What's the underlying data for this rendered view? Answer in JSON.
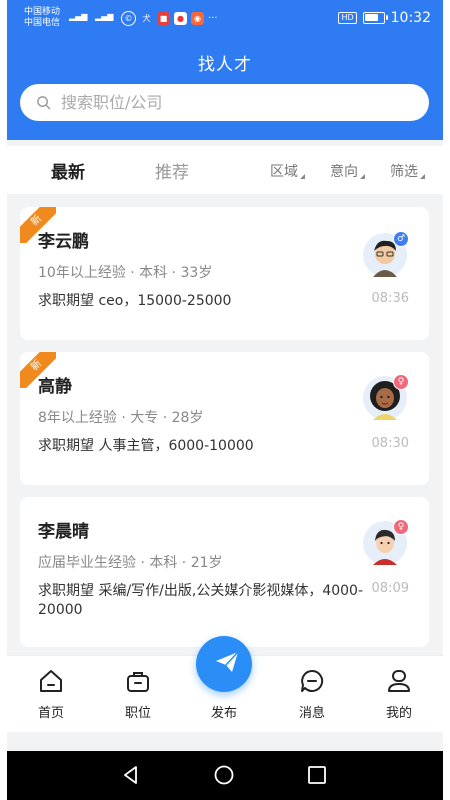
{
  "status_bar": {
    "carrier_1": "中国移动",
    "carrier_2": "中国电信",
    "time": "10:32",
    "hd": "HD",
    "battery_level": 0.8,
    "app_icons": [
      "alipay-like-icon",
      "weibo-icon",
      "map-pin-icon",
      "fox-icon"
    ],
    "more": "···"
  },
  "header": {
    "title": "找人才",
    "search_placeholder": "搜索职位/公司"
  },
  "filters": {
    "tabs": [
      "最新",
      "推荐"
    ],
    "dropdowns": [
      "区域",
      "意向",
      "筛选"
    ]
  },
  "candidates": [
    {
      "name": "李云鹏",
      "meta": "10年以上经验 · 本科 · 33岁",
      "expect": "求职期望 ceo，15000-25000",
      "time": "08:36",
      "is_new": true,
      "new_label": "新",
      "gender": "male"
    },
    {
      "name": "高静",
      "meta": "8年以上经验 · 大专 · 28岁",
      "expect": "求职期望 人事主管，6000-10000",
      "time": "08:30",
      "is_new": true,
      "new_label": "新",
      "gender": "female"
    },
    {
      "name": "李晨晴",
      "meta": "应届毕业生经验 · 本科 · 21岁",
      "expect": "求职期望 采编/写作/出版,公关媒介影视媒体，4000-20000",
      "time": "08:09",
      "is_new": false,
      "gender": "female"
    }
  ],
  "bottom_nav": [
    "首页",
    "职位",
    "发布",
    "消息",
    "我的"
  ],
  "colors": {
    "primary": "#2f7bf2",
    "badge_orange": "#f08a1e",
    "male": "#3d7ff0",
    "female": "#f0697a"
  }
}
